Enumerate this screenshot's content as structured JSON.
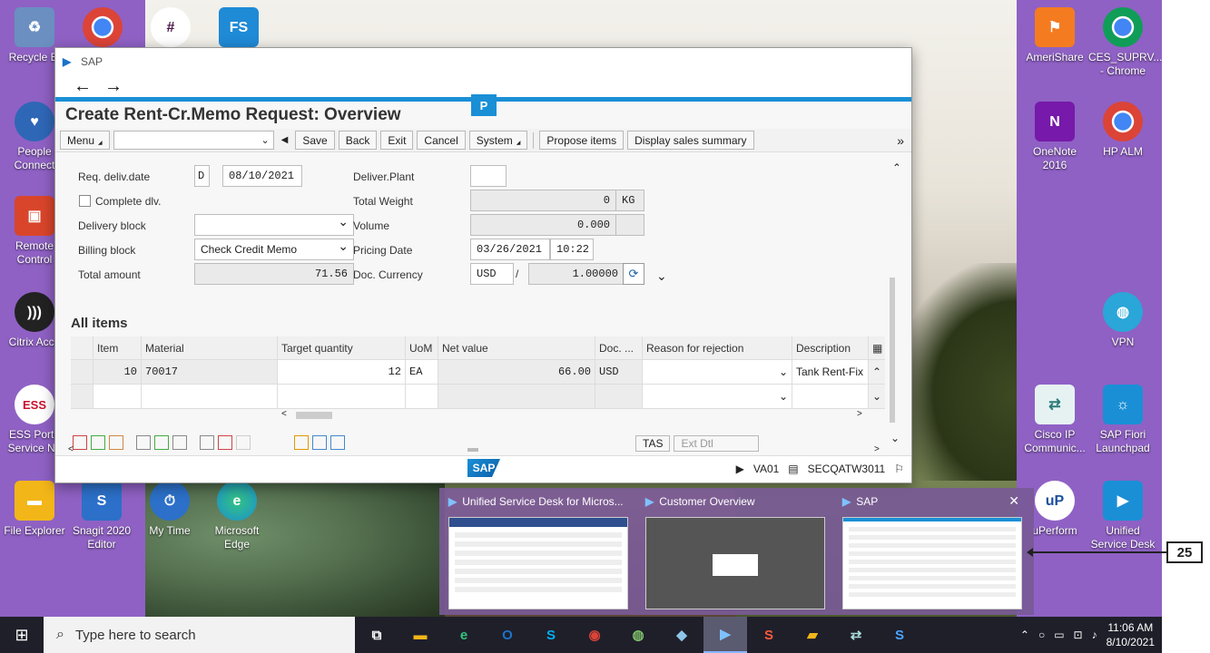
{
  "desktop": {
    "left_icons": [
      {
        "label": "Recycle Bi",
        "icon": "recycle-bin-icon",
        "color": "#6a8fc0"
      },
      {
        "label": "People Connect",
        "icon": "people-connect-icon",
        "color": "#2f67b7"
      },
      {
        "label": "Remote Control",
        "icon": "remote-control-icon",
        "color": "#d9452b"
      },
      {
        "label": "Citrix Acce",
        "icon": "citrix-icon",
        "color": "#222222"
      },
      {
        "label": "ESS Porta Service No",
        "icon": "ess-portal-icon",
        "color": "#c8102e"
      },
      {
        "label": "File Explorer",
        "icon": "file-explorer-icon",
        "color": "#f2b619"
      }
    ],
    "bottom_icons": [
      {
        "label": "Snagit 2020 Editor",
        "icon": "snagit-icon",
        "color": "#2c70c9"
      },
      {
        "label": "My Time",
        "icon": "my-time-icon",
        "color": "#2c70c9"
      },
      {
        "label": "Microsoft Edge",
        "icon": "edge-icon",
        "color": "#1b8fd1"
      }
    ],
    "right_icons": [
      {
        "label": "AmeriShare",
        "icon": "amerishare-icon",
        "color": "#f47b20"
      },
      {
        "label": "CES_SUPRV... - Chrome",
        "icon": "chrome-icon",
        "color": "#2d9d4a"
      },
      {
        "label": "OneNote 2016",
        "icon": "onenote-icon",
        "color": "#7719aa"
      },
      {
        "label": "HP ALM",
        "icon": "chrome-icon",
        "color": "#2d9d4a"
      },
      {
        "label": "VPN",
        "icon": "vpn-icon",
        "color": "#2aa6d8"
      },
      {
        "label": "Cisco IP Communic...",
        "icon": "cisco-icon",
        "color": "#2b7a78"
      },
      {
        "label": "SAP Fiori Launchpad",
        "icon": "sap-fiori-icon",
        "color": "#1a8fd6"
      },
      {
        "label": "uPerform",
        "icon": "uperform-icon",
        "color": "#1a4f9c"
      },
      {
        "label": "Unified Service Desk",
        "icon": "usd-icon",
        "color": "#1a8fd6"
      }
    ]
  },
  "sap": {
    "window_title": "SAP",
    "page_title": "Create Rent-Cr.Memo Request: Overview",
    "toolbar": {
      "menu": "Menu",
      "save": "Save",
      "back": "Back",
      "exit": "Exit",
      "cancel": "Cancel",
      "system": "System",
      "propose": "Propose items",
      "display_summary": "Display sales summary",
      "more": "»"
    },
    "fields": {
      "req_deliv_label": "Req. deliv.date",
      "req_deliv_type": "D",
      "req_deliv_value": "08/10/2021",
      "complete_dlv_label": "Complete dlv.",
      "delivery_block_label": "Delivery block",
      "billing_block_label": "Billing block",
      "billing_block_value": "Check Credit Memo",
      "total_amount_label": "Total amount",
      "total_amount_value": "71.56",
      "deliver_plant_label": "Deliver.Plant",
      "total_weight_label": "Total Weight",
      "total_weight_value": "0",
      "weight_unit": "KG",
      "volume_label": "Volume",
      "volume_value": "0.000",
      "pricing_date_label": "Pricing Date",
      "pricing_date_value": "03/26/2021",
      "pricing_time_value": "10:22",
      "doc_currency_label": "Doc. Currency",
      "doc_currency_value": "USD",
      "exchange_rate": "1.00000"
    },
    "items_title": "All items",
    "grid": {
      "headers": [
        "Item",
        "Material",
        "Target quantity",
        "UoM",
        "Net value",
        "Doc. ...",
        "Reason for rejection",
        "Description"
      ],
      "rows": [
        {
          "item": "10",
          "material": "70017",
          "qty": "12",
          "uom": "EA",
          "net": "66.00",
          "cur": "USD",
          "reason": "",
          "desc": "Tank Rent-Fix"
        }
      ]
    },
    "bottom_buttons": {
      "tas": "TAS",
      "ext": "Ext Dtl"
    },
    "status": {
      "tcode": "VA01",
      "system": "SECQATW3011",
      "logo": "SAP"
    }
  },
  "previews": [
    {
      "title": "Unified Service Desk for Micros..."
    },
    {
      "title": "Customer Overview"
    },
    {
      "title": "SAP"
    }
  ],
  "callout": "25",
  "taskbar": {
    "search_placeholder": "Type here to search",
    "time": "11:06 AM",
    "date": "8/10/2021"
  }
}
